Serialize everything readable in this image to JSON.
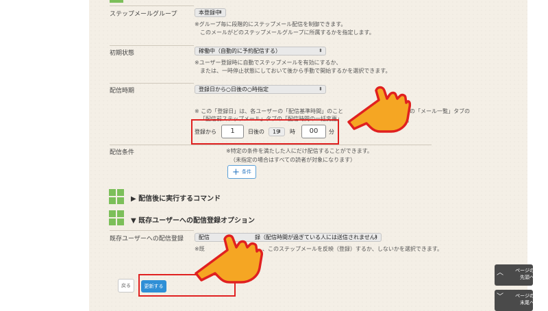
{
  "form": {
    "step_group": {
      "label": "ステップメールグループ",
      "value": "本登録中",
      "notes": [
        "※グループ毎に段階的にステップメール配信を制御できます。",
        "このメールがどのステップメールグループに所属するかを指定します。"
      ]
    },
    "initial_state": {
      "label": "初期状態",
      "value": "稼働中（自動的に予約配信する）",
      "notes": [
        "※ユーザー登録時に自動でステップメールを有効にするか、",
        "または、一時停止状態にしておいて後から手動で開始するかを選択できます。"
      ]
    },
    "timing": {
      "label": "配信時期",
      "value": "登録日から○日後の○時指定",
      "notes": [
        "※ この「登録日」は、各ユーザーの「配信基準時間」のこと",
        "の「メール一覧」タブの",
        "「配信前ステップメール」タブの「配信時間の一括変更」",
        "す。"
      ],
      "from_label": "登録から",
      "days": "1",
      "days_after_label": "日後の",
      "hour": "19",
      "hour_label": "時",
      "minute": "00",
      "minute_label": "分"
    },
    "conditions": {
      "label": "配信条件",
      "notes": [
        "※特定の条件を満たした人にだけ配信することができます。",
        "（未指定の場合はすべての読者が対象になります）"
      ],
      "add_button": "条件"
    },
    "post_command": {
      "title": "▶ 配信後に実行するコマンド"
    },
    "existing_users": {
      "title": "▼ 既存ユーザーへの配信登録オプション",
      "label": "既存ユーザーへの配信登録",
      "value_prefix": "配信",
      "value_suffix": "録（配信時間が過ぎている人には送信されません）",
      "note_prefix": "※既",
      "note_suffix": "、このステップメールを反映（登録）するか、しないかを選択できます。"
    }
  },
  "buttons": {
    "back": "戻る",
    "update": "更新する"
  },
  "scroll": {
    "to_top": "ページの\n先頭へ",
    "to_bottom": "ページの\n末尾へ"
  },
  "colors": {
    "highlight_red": "#e02020",
    "hand_orange": "#f5a623",
    "button_blue": "#2f8fd6",
    "icon_green": "#7cbf5a"
  }
}
